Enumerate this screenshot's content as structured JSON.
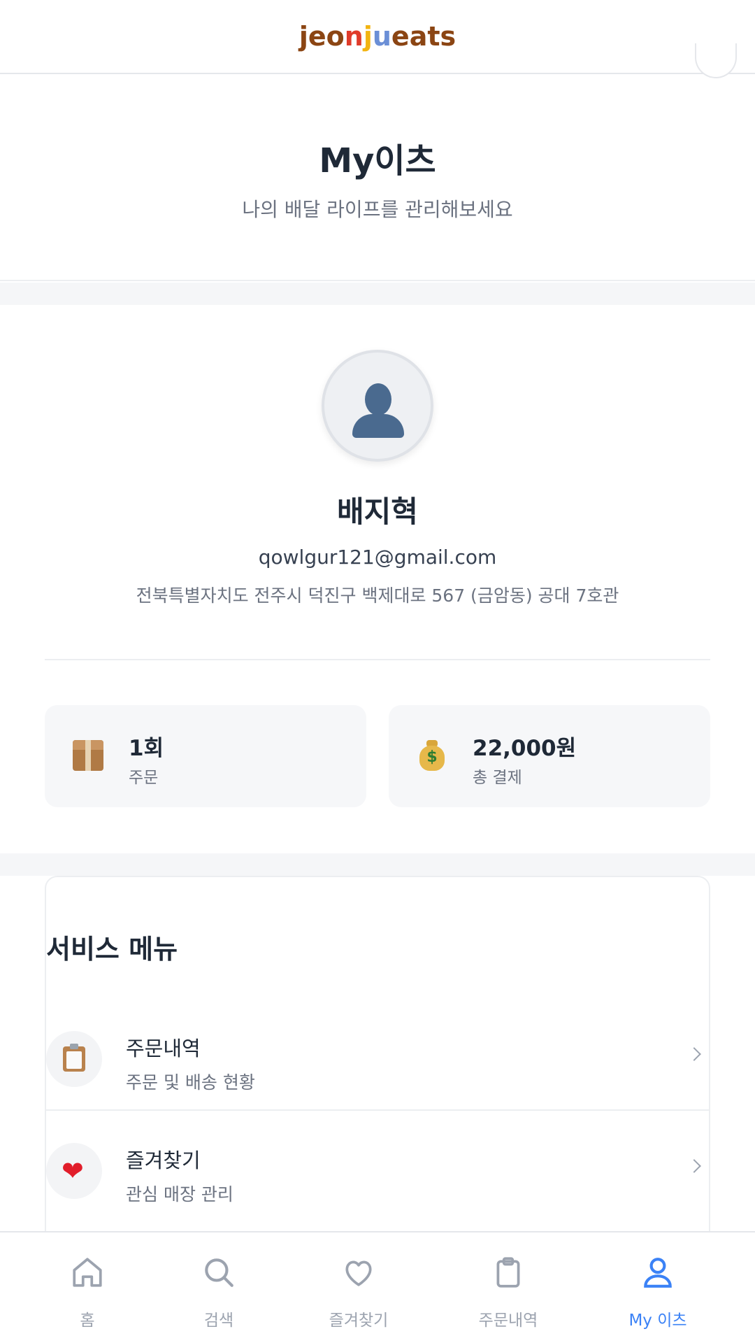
{
  "app": {
    "logo_parts": [
      {
        "text": "jeo",
        "color": "#8b4513"
      },
      {
        "text": "n",
        "color": "#e03b2a"
      },
      {
        "text": "j",
        "color": "#f2b411"
      },
      {
        "text": "u",
        "color": "#6b8fd6"
      },
      {
        "text": "eats",
        "color": "#8b4513"
      }
    ]
  },
  "page": {
    "title": "My이츠",
    "subtitle": "나의 배달 라이프를 관리해보세요"
  },
  "profile": {
    "avatar_icon": "person-silhouette-icon",
    "name": "배지혁",
    "email": "qowlgur121@gmail.com",
    "address": "전북특별자치도 전주시 덕진구 백제대로 567 (금암동) 공대 7호관",
    "stats": [
      {
        "icon": "package-icon",
        "value": "1회",
        "label": "주문"
      },
      {
        "icon": "money-bag-icon",
        "value": "22,000원",
        "label": "총 결제"
      }
    ]
  },
  "service_menu": {
    "title": "서비스 메뉴",
    "items": [
      {
        "icon": "clipboard-icon",
        "title": "주문내역",
        "subtitle": "주문 및 배송 현황"
      },
      {
        "icon": "heart-icon",
        "title": "즐겨찾기",
        "subtitle": "관심 매장 관리"
      }
    ]
  },
  "bottom_nav": {
    "active_color": "#3b82f6",
    "inactive_color": "#9ca3af",
    "items": [
      {
        "icon": "home-icon",
        "label": "홈",
        "active": false
      },
      {
        "icon": "search-icon",
        "label": "검색",
        "active": false
      },
      {
        "icon": "heart-outline-icon",
        "label": "즐겨찾기",
        "active": false
      },
      {
        "icon": "clipboard-icon",
        "label": "주문내역",
        "active": false
      },
      {
        "icon": "user-icon",
        "label": "My 이츠",
        "active": true
      }
    ]
  }
}
